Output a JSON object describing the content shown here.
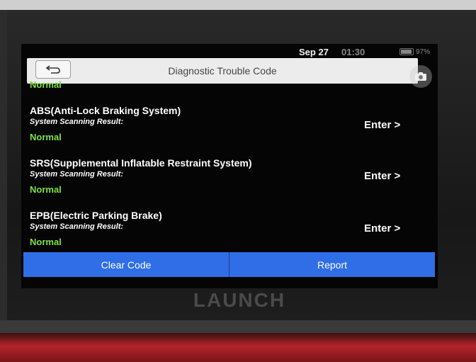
{
  "status_bar": {
    "date": "Sep 27",
    "time": "01:30",
    "battery": "97%"
  },
  "title_bar": {
    "title": "Diagnostic Trouble Code",
    "back_icon": "back-arrow-icon",
    "camera_icon": "camera-icon"
  },
  "list": {
    "top_status": "Normal",
    "items": [
      {
        "system": "ABS(Anti-Lock Braking System)",
        "scan_label": "System Scanning Result:",
        "result": "Normal",
        "action": "Enter >"
      },
      {
        "system": "SRS(Supplemental Inflatable Restraint System)",
        "scan_label": "System Scanning Result:",
        "result": "Normal",
        "action": "Enter >"
      },
      {
        "system": "EPB(Electric Parking Brake)",
        "scan_label": "System Scanning Result:",
        "result": "Normal",
        "action": "Enter >"
      }
    ]
  },
  "bottom_bar": {
    "clear_code": "Clear Code",
    "report": "Report"
  },
  "device": {
    "brand": "LAUNCH"
  },
  "colors": {
    "accent_blue": "#2f6ee6",
    "normal_green": "#7ee044",
    "device_red": "#b3242a"
  }
}
